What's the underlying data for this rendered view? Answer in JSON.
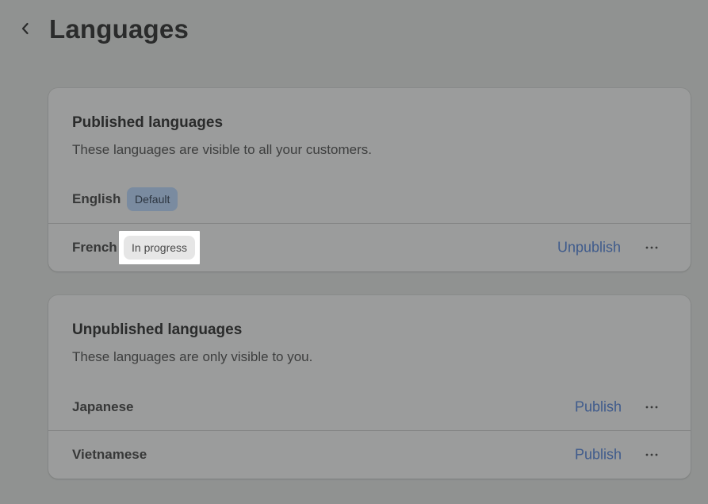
{
  "header": {
    "title": "Languages"
  },
  "published": {
    "title": "Published languages",
    "subtitle": "These languages are visible to all your customers.",
    "rows": [
      {
        "name": "English",
        "badge": "Default"
      },
      {
        "name": "French",
        "badge": "In progress",
        "action": "Unpublish"
      }
    ]
  },
  "unpublished": {
    "title": "Unpublished languages",
    "subtitle": "These languages are only visible to you.",
    "rows": [
      {
        "name": "Japanese",
        "action": "Publish"
      },
      {
        "name": "Vietnamese",
        "action": "Publish"
      }
    ]
  },
  "icons": {
    "back": "chevron-left-icon",
    "more": "ellipsis-horizontal-icon"
  },
  "colors": {
    "background": "#909291",
    "card": "#9b9c9c",
    "link": "#3f5b8c",
    "default_badge": "#7a8ba0",
    "progress_badge": "#e6e6e6"
  }
}
